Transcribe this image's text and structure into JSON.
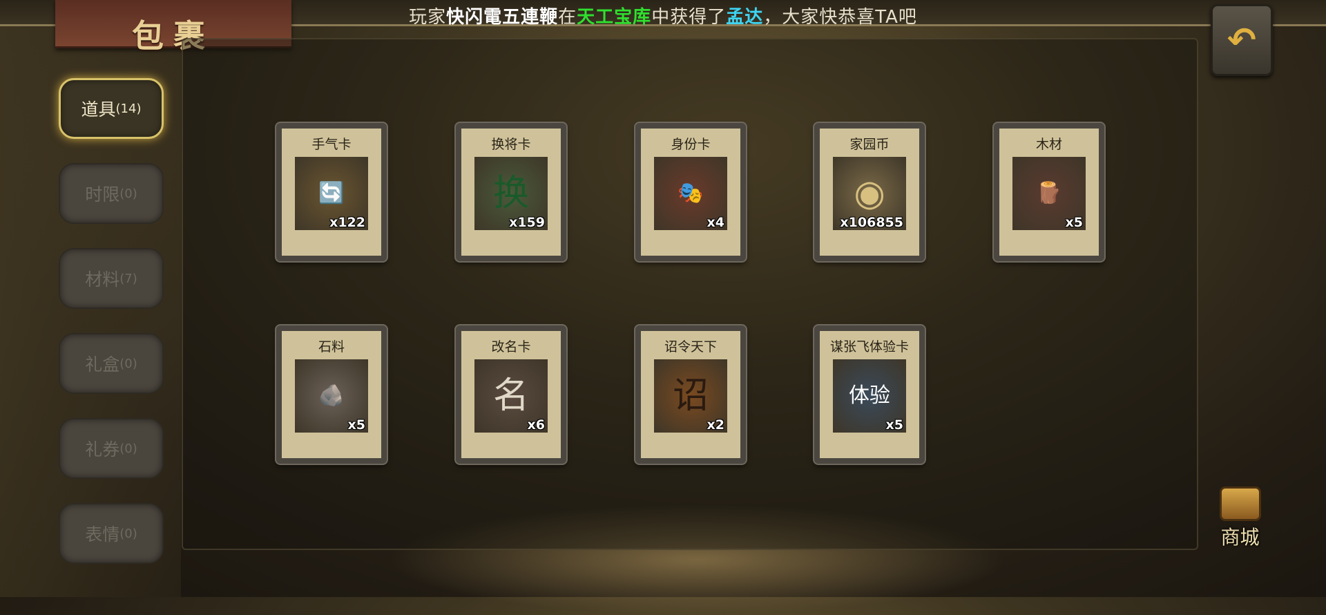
{
  "ticker": {
    "prefix": "玩家",
    "player": "快闪電五連鞭",
    "mid": "在",
    "place": "天工宝库",
    "mid2": "中获得了",
    "item": "孟达",
    "suffix": "，大家快恭喜TA吧"
  },
  "title": "包裹",
  "tabs": [
    {
      "label": "道具",
      "count": "(14)",
      "active": true
    },
    {
      "label": "时限",
      "count": "(0)"
    },
    {
      "label": "材料",
      "count": "(7)"
    },
    {
      "label": "礼盒",
      "count": "(0)"
    },
    {
      "label": "礼券",
      "count": "(0)"
    },
    {
      "label": "表情",
      "count": "(0)"
    }
  ],
  "items": [
    {
      "name": "手气卡",
      "qty": "x122",
      "icon": "swap-ring-card-icon",
      "glyph": "🔄"
    },
    {
      "name": "换将卡",
      "qty": "x159",
      "icon": "jade-token-icon",
      "glyph": "换"
    },
    {
      "name": "身份卡",
      "qty": "x4",
      "icon": "opera-mask-icon",
      "glyph": "🎭"
    },
    {
      "name": "家园币",
      "qty": "x106855",
      "icon": "coin-icon",
      "glyph": "◉"
    },
    {
      "name": "木材",
      "qty": "x5",
      "icon": "wood-icon",
      "glyph": "🪵"
    },
    {
      "name": "石料",
      "qty": "x5",
      "icon": "stone-icon",
      "glyph": "🪨"
    },
    {
      "name": "改名卡",
      "qty": "x6",
      "icon": "name-tag-icon",
      "glyph": "名"
    },
    {
      "name": "诏令天下",
      "qty": "x2",
      "icon": "scroll-icon",
      "glyph": "诏"
    },
    {
      "name": "谋张飞体验卡",
      "qty": "x5",
      "icon": "general-portrait-icon",
      "glyph": "体验"
    }
  ],
  "back_icon": "back-arrow-icon",
  "shop": {
    "label": "商城",
    "icon": "chest-icon"
  }
}
